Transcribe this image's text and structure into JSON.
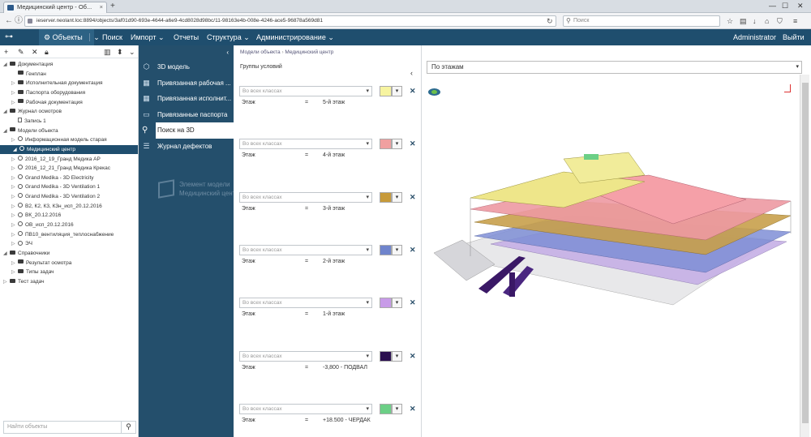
{
  "browser": {
    "tab_title": "Медицинский центр - Об...",
    "url": "ieserver.neolant.loc:8894/objects/3af01d90-693e-4644-a6e9-4cd8028d98bc/11-98163e4b-008e-4246-ace5-96878a569d81",
    "search_placeholder": "Поиск",
    "new_tab": "+",
    "minimize": "—",
    "maximize": "☐",
    "close": "✕"
  },
  "appbar": {
    "objects_label": "Объекты",
    "menu": [
      "Поиск",
      "Импорт",
      "Отчеты",
      "Структура",
      "Администрирование"
    ],
    "user": "Administrator",
    "logout": "Выйти"
  },
  "tree": [
    {
      "label": "Документация",
      "level": 0,
      "arrow": "◢",
      "icon": "folder"
    },
    {
      "label": "Генплан",
      "level": 1,
      "arrow": "",
      "icon": "folder"
    },
    {
      "label": "Исполнительная документация",
      "level": 1,
      "arrow": "▷",
      "icon": "folder"
    },
    {
      "label": "Паспорта оборудования",
      "level": 1,
      "arrow": "▷",
      "icon": "folder"
    },
    {
      "label": "Рабочая документация",
      "level": 1,
      "arrow": "▷",
      "icon": "folder"
    },
    {
      "label": "Журнал осмотров",
      "level": 0,
      "arrow": "◢",
      "icon": "folder"
    },
    {
      "label": "Запись 1",
      "level": 1,
      "arrow": "",
      "icon": "file"
    },
    {
      "label": "Модели объекта",
      "level": 0,
      "arrow": "◢",
      "icon": "folder"
    },
    {
      "label": "Информационная модель старая",
      "level": 1,
      "arrow": "▷",
      "icon": "gear"
    },
    {
      "label": "Медицинский центр",
      "level": 0,
      "arrow": "◢",
      "icon": "gear",
      "selected": true
    },
    {
      "label": "2016_12_19_Гранд Медика АР",
      "level": 1,
      "arrow": "▷",
      "icon": "gear"
    },
    {
      "label": "2016_12_21_Гранд Медика Крекас",
      "level": 1,
      "arrow": "▷",
      "icon": "gear"
    },
    {
      "label": "Grand Medika - 3D Electricity",
      "level": 1,
      "arrow": "▷",
      "icon": "gear"
    },
    {
      "label": "Grand Medika - 3D Ventilation 1",
      "level": 1,
      "arrow": "▷",
      "icon": "gear"
    },
    {
      "label": "Grand Medika - 3D Ventilation 2",
      "level": 1,
      "arrow": "▷",
      "icon": "gear"
    },
    {
      "label": "В2, К2, К3, К3н_исп_20.12.2016",
      "level": 1,
      "arrow": "▷",
      "icon": "gear"
    },
    {
      "label": "ВК_20.12.2016",
      "level": 1,
      "arrow": "▷",
      "icon": "gear"
    },
    {
      "label": "ОВ_исп_20.12.2016",
      "level": 1,
      "arrow": "▷",
      "icon": "gear"
    },
    {
      "label": "ПВ10_вентиляция_теплоснабжение",
      "level": 1,
      "arrow": "▷",
      "icon": "gear"
    },
    {
      "label": "ЭЧ",
      "level": 1,
      "arrow": "▷",
      "icon": "gear"
    },
    {
      "label": "Справочники",
      "level": 0,
      "arrow": "◢",
      "icon": "folder"
    },
    {
      "label": "Результат осмотра",
      "level": 1,
      "arrow": "▷",
      "icon": "folder"
    },
    {
      "label": "Типы задач",
      "level": 1,
      "arrow": "▷",
      "icon": "folder"
    },
    {
      "label": "Тест задач",
      "level": 0,
      "arrow": "▷",
      "icon": "folder"
    }
  ],
  "sidebar_search_placeholder": "Найти объекты",
  "dark_menu": {
    "items": [
      {
        "label": "3D модель",
        "icon": "⬡"
      },
      {
        "label": "Привязанная рабочая ...",
        "icon": "▦"
      },
      {
        "label": "Привязанная исполнит...",
        "icon": "▦"
      },
      {
        "label": "Привязанные паспорта",
        "icon": "▭"
      },
      {
        "label": "Поиск на 3D",
        "icon": "⚲",
        "active": true
      },
      {
        "label": "Журнал дефектов",
        "icon": "☰"
      }
    ],
    "element_title": "Элемент модели",
    "element_sub": "Медицинский центр"
  },
  "breadcrumb": [
    "Модели объекта",
    "Медицинский центр"
  ],
  "groups_title": "Группы условий",
  "conditions": [
    {
      "class": "Во всех классах",
      "field": "Этаж",
      "op": "=",
      "value": "5-й этаж",
      "color": "#f7f4a0"
    },
    {
      "class": "Во всех классах",
      "field": "Этаж",
      "op": "=",
      "value": "4-й этаж",
      "color": "#f0a0a0"
    },
    {
      "class": "Во всех классах",
      "field": "Этаж",
      "op": "=",
      "value": "3-й этаж",
      "color": "#c79a3a"
    },
    {
      "class": "Во всех классах",
      "field": "Этаж",
      "op": "=",
      "value": "2-й этаж",
      "color": "#6f84cc"
    },
    {
      "class": "Во всех классах",
      "field": "Этаж",
      "op": "=",
      "value": "1-й этаж",
      "color": "#c89be8"
    },
    {
      "class": "Во всех классах",
      "field": "Этаж",
      "op": "=",
      "value": "-3,800 - ПОДВАЛ",
      "color": "#2b0f4f"
    },
    {
      "class": "Во всех классах",
      "field": "Этаж",
      "op": "=",
      "value": "+18.500 - ЧЕРДАК",
      "color": "#6ccf86"
    }
  ],
  "viewer": {
    "mode": "По этажам"
  }
}
